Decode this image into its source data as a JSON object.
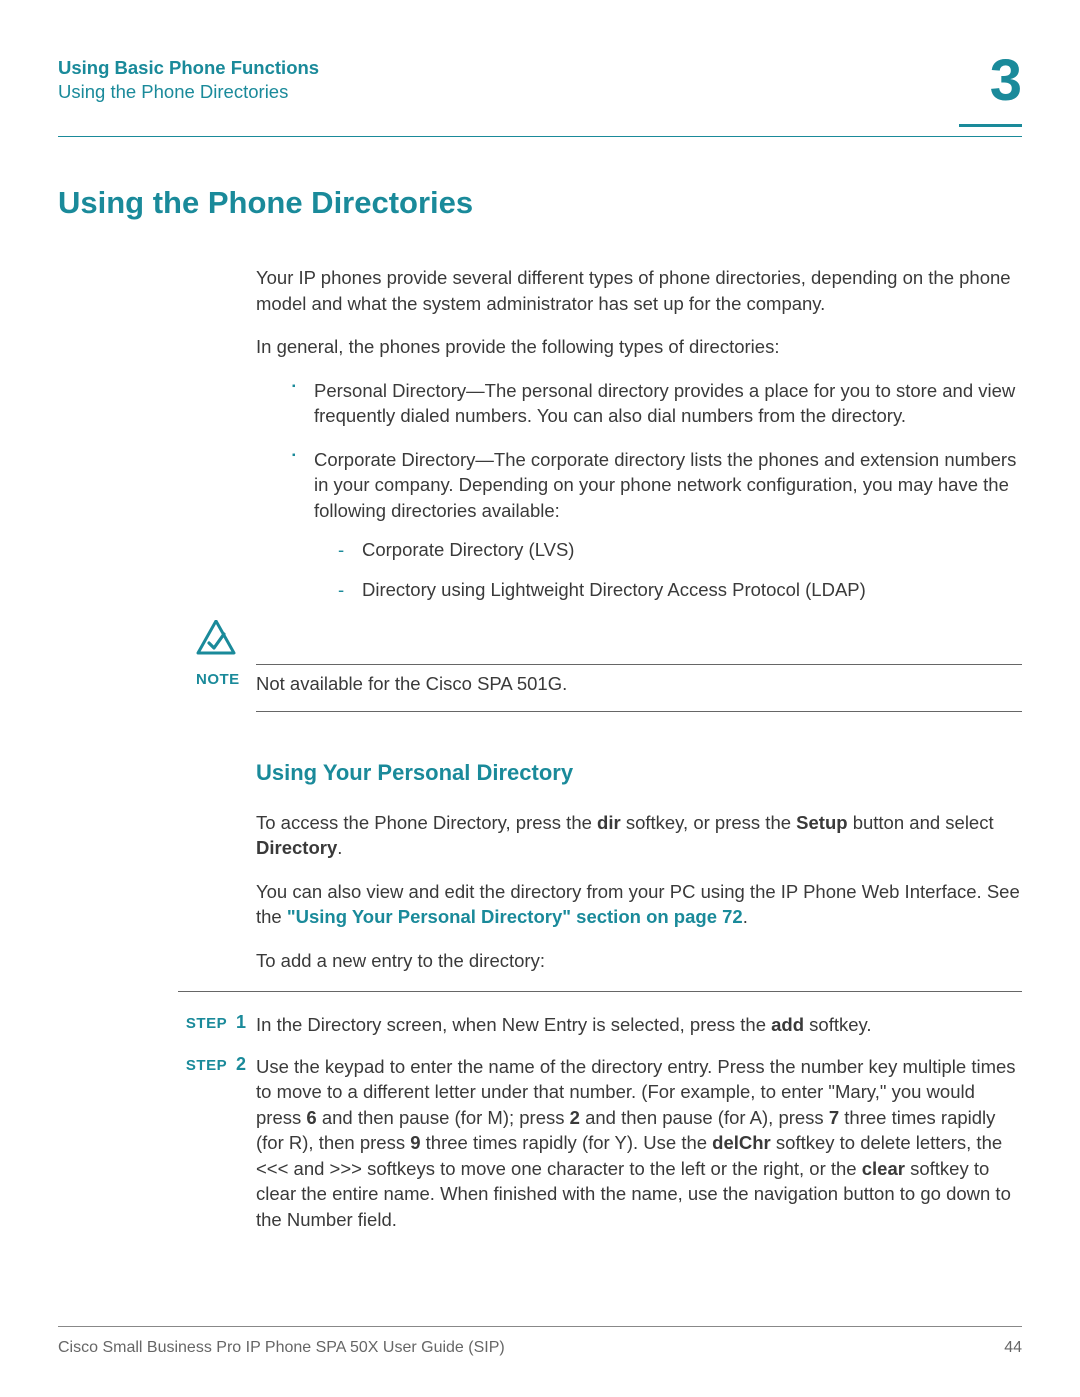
{
  "header": {
    "chapter_title": "Using Basic Phone Functions",
    "section_title": "Using the Phone Directories",
    "chapter_number": "3"
  },
  "main_heading": "Using the Phone Directories",
  "intro": {
    "p1": "Your IP phones provide several different types of phone directories, depending on the phone model and what the system administrator has set up for the company.",
    "p2": "In general, the phones provide the following types of directories:"
  },
  "bullets": {
    "b1": "Personal Directory—The personal directory provides a place for you to store and view frequently dialed numbers. You can also dial numbers from the directory.",
    "b2": "Corporate Directory—The corporate directory lists the phones and extension numbers in your company. Depending on your phone network configuration, you may have the following directories available:",
    "b2_sub1": "Corporate Directory (LVS)",
    "b2_sub2": "Directory using Lightweight Directory Access Protocol (LDAP)"
  },
  "note": {
    "label": "NOTE",
    "text": "Not available for the Cisco SPA 501G."
  },
  "subsection": {
    "heading": "Using Your Personal Directory",
    "p1_part1": "To access the Phone Directory, press the ",
    "p1_b1": "dir",
    "p1_part2": " softkey, or press the ",
    "p1_b2": "Setup",
    "p1_part3": " button and select ",
    "p1_b3": "Directory",
    "p1_part4": ".",
    "p2_part1": "You can also view and edit the directory from your PC using the IP Phone Web Interface. See the ",
    "p2_link": "\"Using Your Personal Directory\" section on page 72",
    "p2_part2": ".",
    "p3": "To add a new entry to the directory:"
  },
  "steps": {
    "label": "STEP",
    "s1_num": "1",
    "s1_part1": "In the Directory screen, when New Entry is selected, press the ",
    "s1_b1": "add",
    "s1_part2": " softkey.",
    "s2_num": "2",
    "s2_part1": "Use the keypad to enter the name of the directory entry. Press the number key multiple times to move to a different letter under that number. (For example, to enter \"Mary,\" you would press ",
    "s2_b1": "6",
    "s2_part2": " and then pause (for M); press ",
    "s2_b2": "2",
    "s2_part3": " and then pause (for A), press ",
    "s2_b3": "7",
    "s2_part4": " three times rapidly (for R), then press ",
    "s2_b4": "9",
    "s2_part5": " three times rapidly (for Y). Use the ",
    "s2_b5": "delChr",
    "s2_part6": " softkey to delete letters, the <<< and >>> softkeys to move one character to the left or the right, or the ",
    "s2_b6": "clear",
    "s2_part7": " softkey to clear the entire name. When finished with the name, use the navigation button to go down to the Number field."
  },
  "footer": {
    "left": "Cisco Small Business Pro IP Phone SPA 50X User Guide (SIP)",
    "right": "44"
  }
}
